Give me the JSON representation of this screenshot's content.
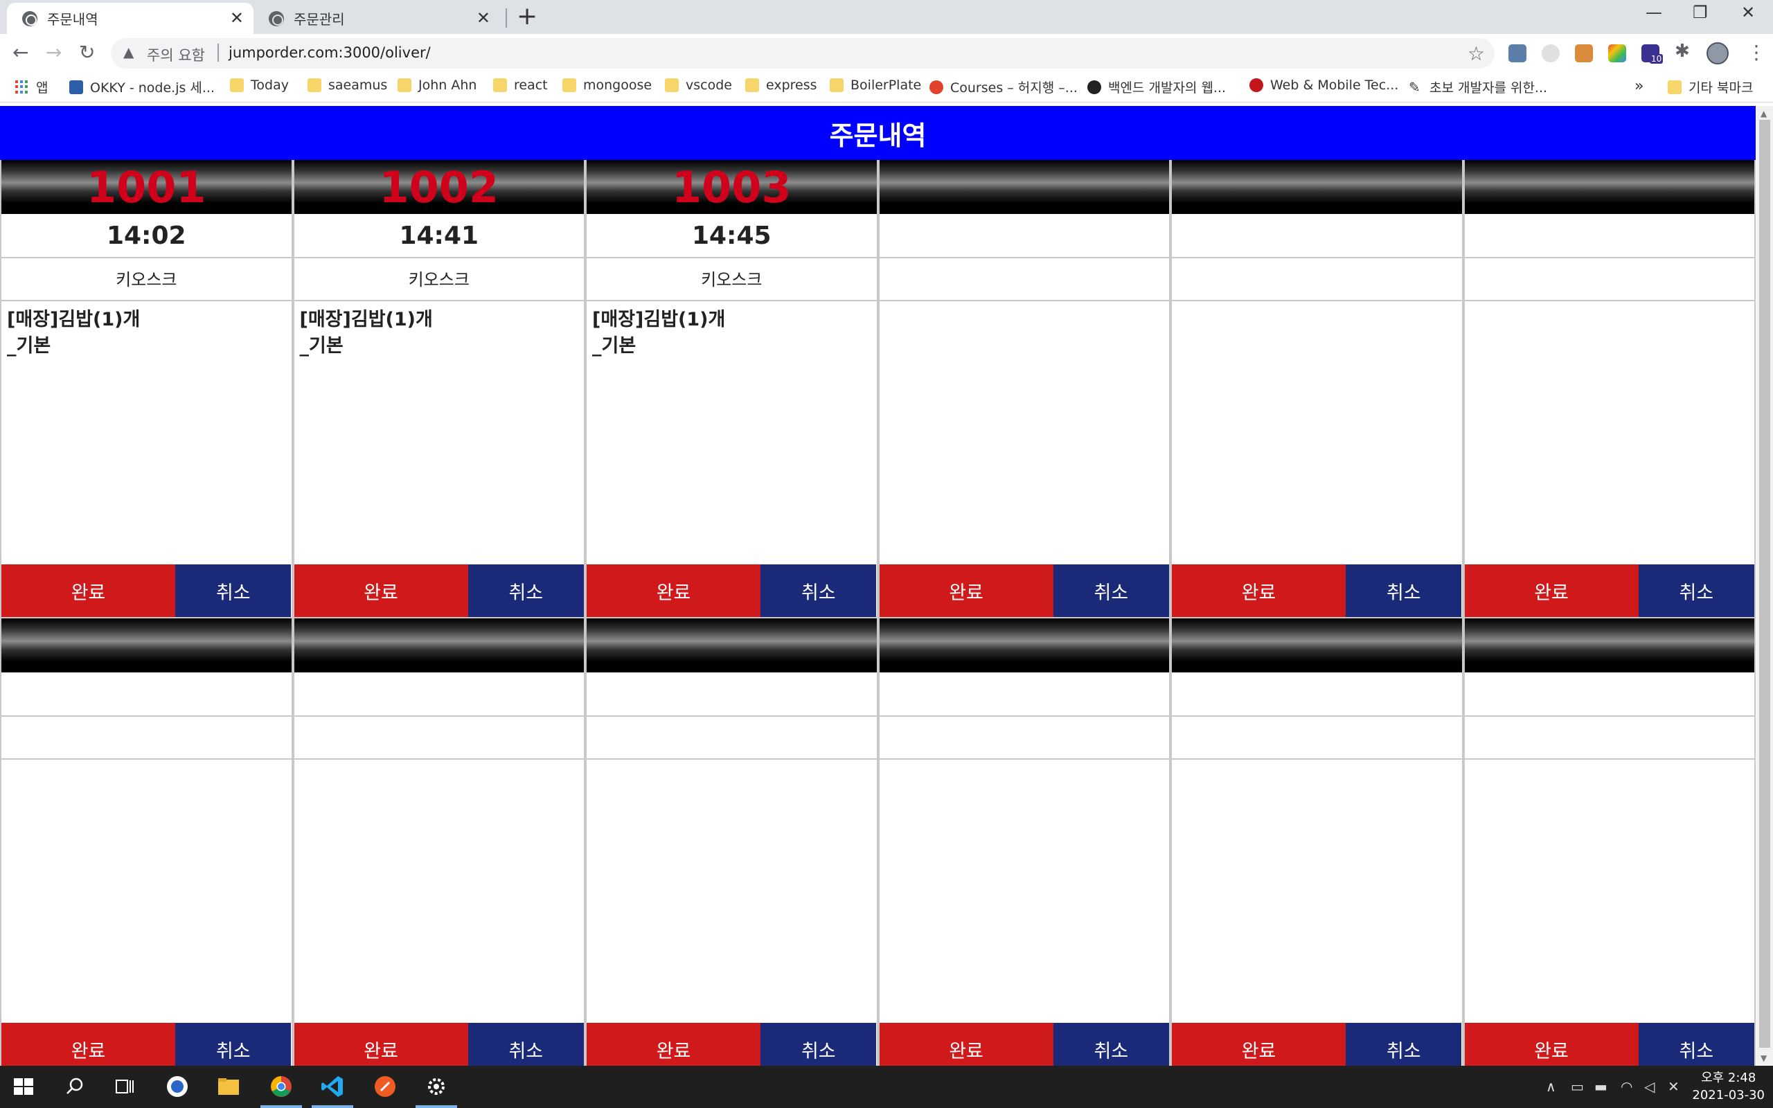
{
  "browser": {
    "tabs": [
      {
        "title": "주문내역",
        "active": true
      },
      {
        "title": "주문관리",
        "active": false
      }
    ],
    "address": {
      "security_label": "주의 요함",
      "url": "jumporder.com:3000/oliver/"
    },
    "bookmarks": [
      {
        "label": "앱",
        "icon": "apps-grid-icon"
      },
      {
        "label": "OKKY - node.js 세...",
        "icon": "okky-icon"
      },
      {
        "label": "Today",
        "icon": "folder-icon"
      },
      {
        "label": "saeamus",
        "icon": "folder-icon"
      },
      {
        "label": "John Ahn",
        "icon": "folder-icon"
      },
      {
        "label": "react",
        "icon": "folder-icon"
      },
      {
        "label": "mongoose",
        "icon": "folder-icon"
      },
      {
        "label": "vscode",
        "icon": "folder-icon"
      },
      {
        "label": "express",
        "icon": "folder-icon"
      },
      {
        "label": "BoilerPlate",
        "icon": "folder-icon"
      },
      {
        "label": "Courses – 허지행 –...",
        "icon": "apple-icon"
      },
      {
        "label": "백엔드 개발자의 웹...",
        "icon": "github-icon"
      },
      {
        "label": "Web & Mobile Tec...",
        "icon": "site-icon"
      },
      {
        "label": "초보 개발자를 위한...",
        "icon": "pen-icon"
      }
    ],
    "bookmarks_overflow": "»",
    "other_bookmarks": "기타 북마크",
    "extension_badge": "10"
  },
  "page": {
    "title": "주문내역",
    "colors": {
      "header": "#0000ff",
      "order_number": "#d0021b",
      "done": "#d0191b",
      "cancel": "#1a2a78"
    },
    "done_label": "완료",
    "cancel_label": "취소",
    "orders": [
      {
        "number": "1001",
        "time": "14:02",
        "source": "키오스크",
        "items_line1": "[매장]김밥(1)개",
        "items_line2": "_기본"
      },
      {
        "number": "1002",
        "time": "14:41",
        "source": "키오스크",
        "items_line1": "[매장]김밥(1)개",
        "items_line2": "_기본"
      },
      {
        "number": "1003",
        "time": "14:45",
        "source": "키오스크",
        "items_line1": "[매장]김밥(1)개",
        "items_line2": "_기본"
      },
      {
        "number": "",
        "time": "",
        "source": "",
        "items_line1": "",
        "items_line2": ""
      },
      {
        "number": "",
        "time": "",
        "source": "",
        "items_line1": "",
        "items_line2": ""
      },
      {
        "number": "",
        "time": "",
        "source": "",
        "items_line1": "",
        "items_line2": ""
      },
      {
        "number": "",
        "time": "",
        "source": "",
        "items_line1": "",
        "items_line2": ""
      },
      {
        "number": "",
        "time": "",
        "source": "",
        "items_line1": "",
        "items_line2": ""
      },
      {
        "number": "",
        "time": "",
        "source": "",
        "items_line1": "",
        "items_line2": ""
      },
      {
        "number": "",
        "time": "",
        "source": "",
        "items_line1": "",
        "items_line2": ""
      },
      {
        "number": "",
        "time": "",
        "source": "",
        "items_line1": "",
        "items_line2": ""
      },
      {
        "number": "",
        "time": "",
        "source": "",
        "items_line1": "",
        "items_line2": ""
      }
    ]
  },
  "taskbar": {
    "apps": [
      "windows-start-icon",
      "search-icon",
      "task-view-icon",
      "cortana-icon",
      "file-explorer-icon",
      "chrome-icon",
      "vscode-icon",
      "postman-icon",
      "settings-icon"
    ],
    "clock_time": "오후 2:48",
    "clock_date": "2021-03-30"
  }
}
